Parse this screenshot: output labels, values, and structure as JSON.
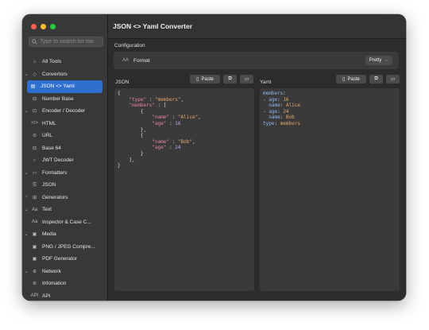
{
  "sidebar": {
    "search_placeholder": "Type to search for too",
    "items": [
      {
        "label": "All Tools",
        "icon": "home-icon",
        "chev": ""
      },
      {
        "label": "Convertors",
        "icon": "convert-icon",
        "chev": "⌄"
      },
      {
        "label": "JSON <> Yaml",
        "icon": "doc-icon",
        "chev": "",
        "selected": true
      },
      {
        "label": "Number Base",
        "icon": "number-icon",
        "chev": ""
      },
      {
        "label": "Encoder / Decoder",
        "icon": "encoder-icon",
        "chev": "⌄"
      },
      {
        "label": "HTML",
        "icon": "code-icon",
        "chev": ""
      },
      {
        "label": "URL",
        "icon": "link-icon",
        "chev": ""
      },
      {
        "label": "Base 64",
        "icon": "base64-icon",
        "chev": ""
      },
      {
        "label": "JWT Decoder",
        "icon": "jwt-icon",
        "chev": ""
      },
      {
        "label": "Formatters",
        "icon": "formatter-icon",
        "chev": "⌄"
      },
      {
        "label": "JSON",
        "icon": "json-icon",
        "chev": ""
      },
      {
        "label": "Generators",
        "icon": "generator-icon",
        "chev": "›"
      },
      {
        "label": "Text",
        "icon": "text-icon",
        "chev": "⌄"
      },
      {
        "label": "Inspector & Case C...",
        "icon": "case-icon",
        "chev": ""
      },
      {
        "label": "Media",
        "icon": "media-icon",
        "chev": "⌄"
      },
      {
        "label": "PNG / JPEG Compre...",
        "icon": "image-icon",
        "chev": ""
      },
      {
        "label": "PDF Generator",
        "icon": "pdf-icon",
        "chev": ""
      },
      {
        "label": "Network",
        "icon": "globe-icon",
        "chev": "⌄"
      },
      {
        "label": "Infomation",
        "icon": "info-icon",
        "chev": ""
      },
      {
        "label": "API",
        "icon": "api-icon",
        "chev": ""
      }
    ]
  },
  "main": {
    "title": "JSON <> Yaml Converter",
    "config_label": "Configuration",
    "format_icon": "AA",
    "format_label": "Format",
    "format_value": "Pretty",
    "json_pane": {
      "title": "JSON",
      "paste_label": "Paste"
    },
    "yaml_pane": {
      "title": "Yaml",
      "paste_label": "Paste"
    }
  },
  "json_text": [
    [
      [
        "p",
        "{"
      ]
    ],
    [
      [
        "p",
        "    "
      ],
      [
        "k",
        "\"type\""
      ],
      [
        "p",
        " : "
      ],
      [
        "s",
        "\"members\""
      ],
      [
        "p",
        ","
      ]
    ],
    [
      [
        "p",
        "    "
      ],
      [
        "k",
        "\"members\""
      ],
      [
        "p",
        " : ["
      ]
    ],
    [
      [
        "p",
        "        {"
      ]
    ],
    [
      [
        "p",
        "            "
      ],
      [
        "k",
        "\"name\""
      ],
      [
        "p",
        " : "
      ],
      [
        "s",
        "\"Alice\""
      ],
      [
        "p",
        ","
      ]
    ],
    [
      [
        "p",
        "            "
      ],
      [
        "k",
        "\"age\""
      ],
      [
        "p",
        " : "
      ],
      [
        "n",
        "16"
      ]
    ],
    [
      [
        "p",
        "        },"
      ]
    ],
    [
      [
        "p",
        "        {"
      ]
    ],
    [
      [
        "p",
        "            "
      ],
      [
        "k",
        "\"name\""
      ],
      [
        "p",
        " : "
      ],
      [
        "s",
        "\"Bob\""
      ],
      [
        "p",
        ","
      ]
    ],
    [
      [
        "p",
        "            "
      ],
      [
        "k",
        "\"age\""
      ],
      [
        "p",
        " : "
      ],
      [
        "n",
        "24"
      ]
    ],
    [
      [
        "p",
        "        }"
      ]
    ],
    [
      [
        "p",
        "    ],"
      ]
    ],
    [
      [
        "p",
        "}"
      ]
    ]
  ],
  "yaml_text": [
    [
      [
        "yk",
        "members"
      ],
      [
        "yp",
        ":"
      ]
    ],
    [
      [
        "yp",
        "- "
      ],
      [
        "yk",
        "age"
      ],
      [
        "yp",
        ": "
      ],
      [
        "yv",
        "16"
      ]
    ],
    [
      [
        "yp",
        "  "
      ],
      [
        "yk",
        "name"
      ],
      [
        "yp",
        ": "
      ],
      [
        "yv",
        "Alice"
      ]
    ],
    [
      [
        "yp",
        "- "
      ],
      [
        "yk",
        "age"
      ],
      [
        "yp",
        ": "
      ],
      [
        "yv",
        "24"
      ]
    ],
    [
      [
        "yp",
        "  "
      ],
      [
        "yk",
        "name"
      ],
      [
        "yp",
        ": "
      ],
      [
        "yv",
        "Bob"
      ]
    ],
    [
      [
        "yk",
        "type"
      ],
      [
        "yp",
        ": "
      ],
      [
        "yv",
        "members"
      ]
    ]
  ]
}
